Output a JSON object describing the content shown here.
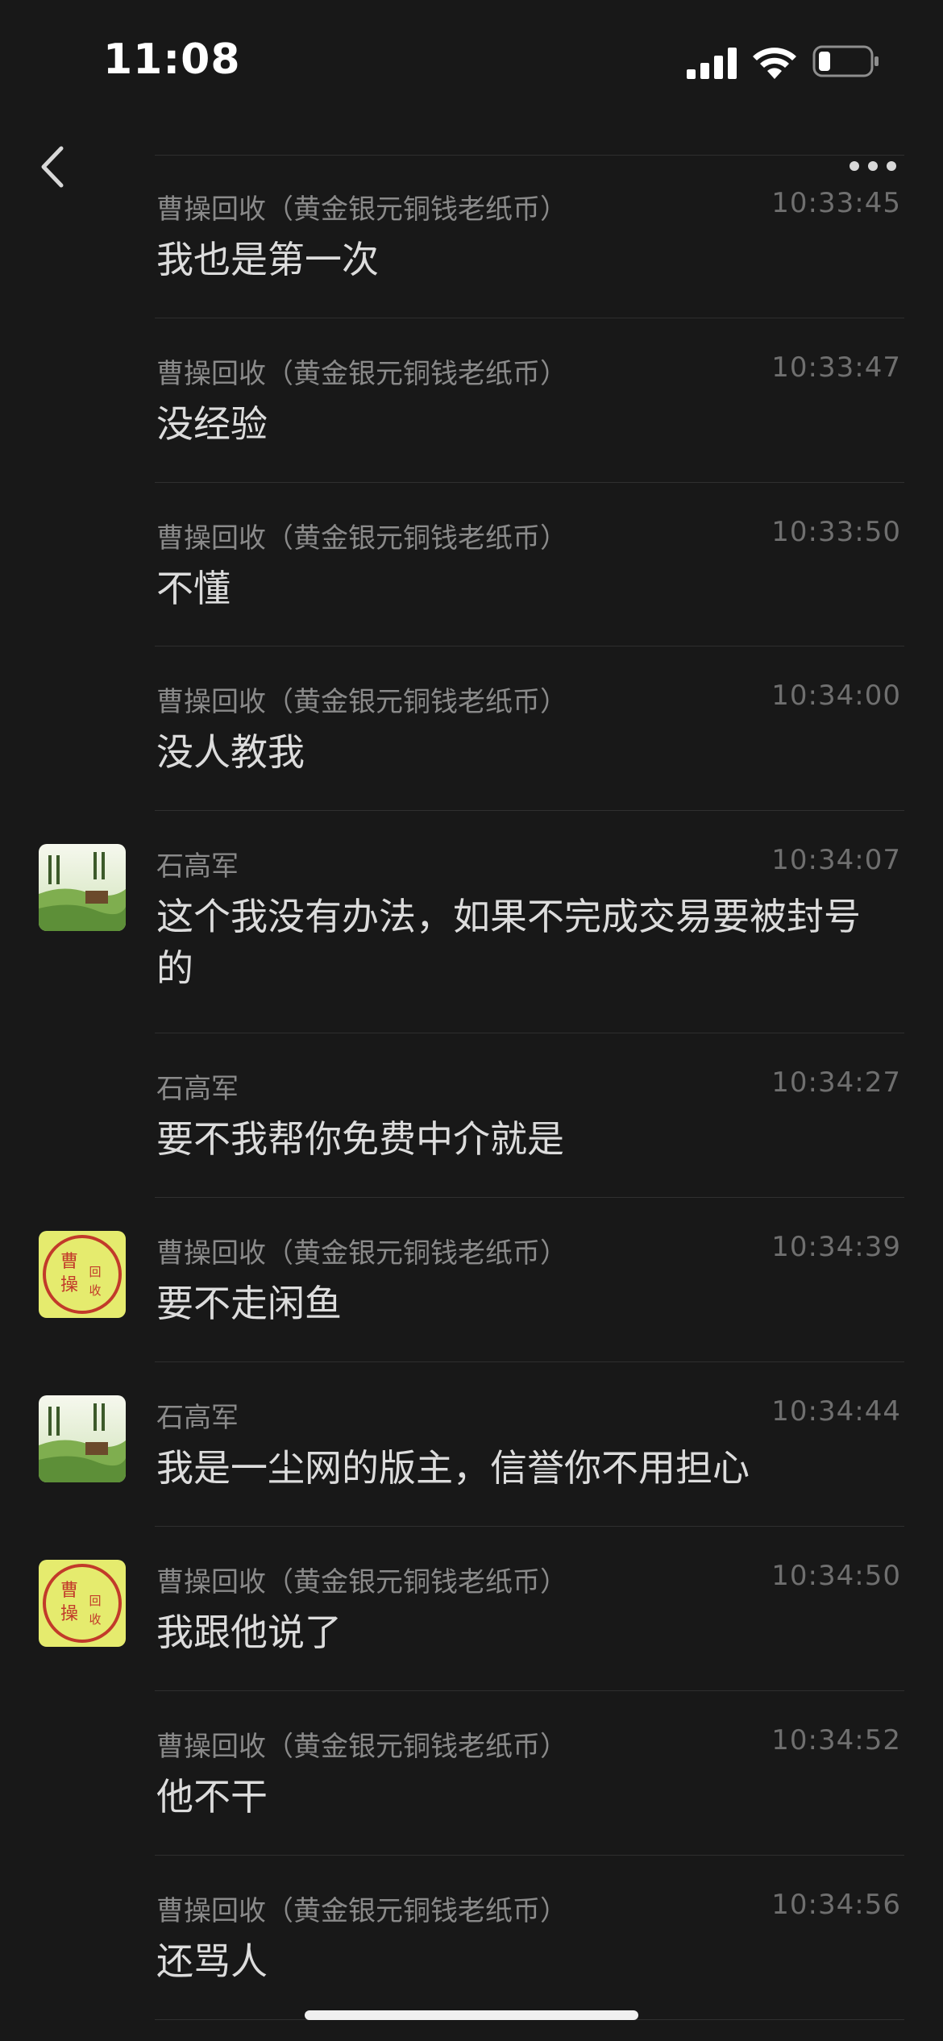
{
  "status_bar": {
    "time": "11:08",
    "icons": [
      "cellular-signal-icon",
      "wifi-icon",
      "battery-icon"
    ],
    "battery_level": 0.22
  },
  "nav": {
    "back_icon": "chevron-left-icon",
    "more_icon": "ellipsis-icon"
  },
  "colors": {
    "background": "#181818",
    "sender": "#8a8a8a",
    "timestamp": "#6f6f6f",
    "message_text": "#dcdcdc",
    "divider": "#2f2f2f"
  },
  "messages": [
    {
      "sender": "曹操回收（黄金银元铜钱老纸币）",
      "time": "10:33:45",
      "text": "我也是第一次",
      "avatar": ""
    },
    {
      "sender": "曹操回收（黄金银元铜钱老纸币）",
      "time": "10:33:47",
      "text": "没经验",
      "avatar": ""
    },
    {
      "sender": "曹操回收（黄金银元铜钱老纸币）",
      "time": "10:33:50",
      "text": "不懂",
      "avatar": ""
    },
    {
      "sender": "曹操回收（黄金银元铜钱老纸币）",
      "time": "10:34:00",
      "text": "没人教我",
      "avatar": ""
    },
    {
      "sender": "石高军",
      "time": "10:34:07",
      "text": "这个我没有办法，如果不完成交易要被封号的",
      "avatar": "landscape-avatar"
    },
    {
      "sender": "石高军",
      "time": "10:34:27",
      "text": "要不我帮你免费中介就是",
      "avatar": ""
    },
    {
      "sender": "曹操回收（黄金银元铜钱老纸币）",
      "time": "10:34:39",
      "text": "要不走闲鱼",
      "avatar": "seal-avatar"
    },
    {
      "sender": "石高军",
      "time": "10:34:44",
      "text": "我是一尘网的版主，信誉你不用担心",
      "avatar": "landscape-avatar"
    },
    {
      "sender": "曹操回收（黄金银元铜钱老纸币）",
      "time": "10:34:50",
      "text": "我跟他说了",
      "avatar": "seal-avatar"
    },
    {
      "sender": "曹操回收（黄金银元铜钱老纸币）",
      "time": "10:34:52",
      "text": "他不干",
      "avatar": ""
    },
    {
      "sender": "曹操回收（黄金银元铜钱老纸币）",
      "time": "10:34:56",
      "text": "还骂人",
      "avatar": ""
    }
  ],
  "seal_avatar_chars": [
    "曹",
    "操",
    "回",
    "收"
  ]
}
